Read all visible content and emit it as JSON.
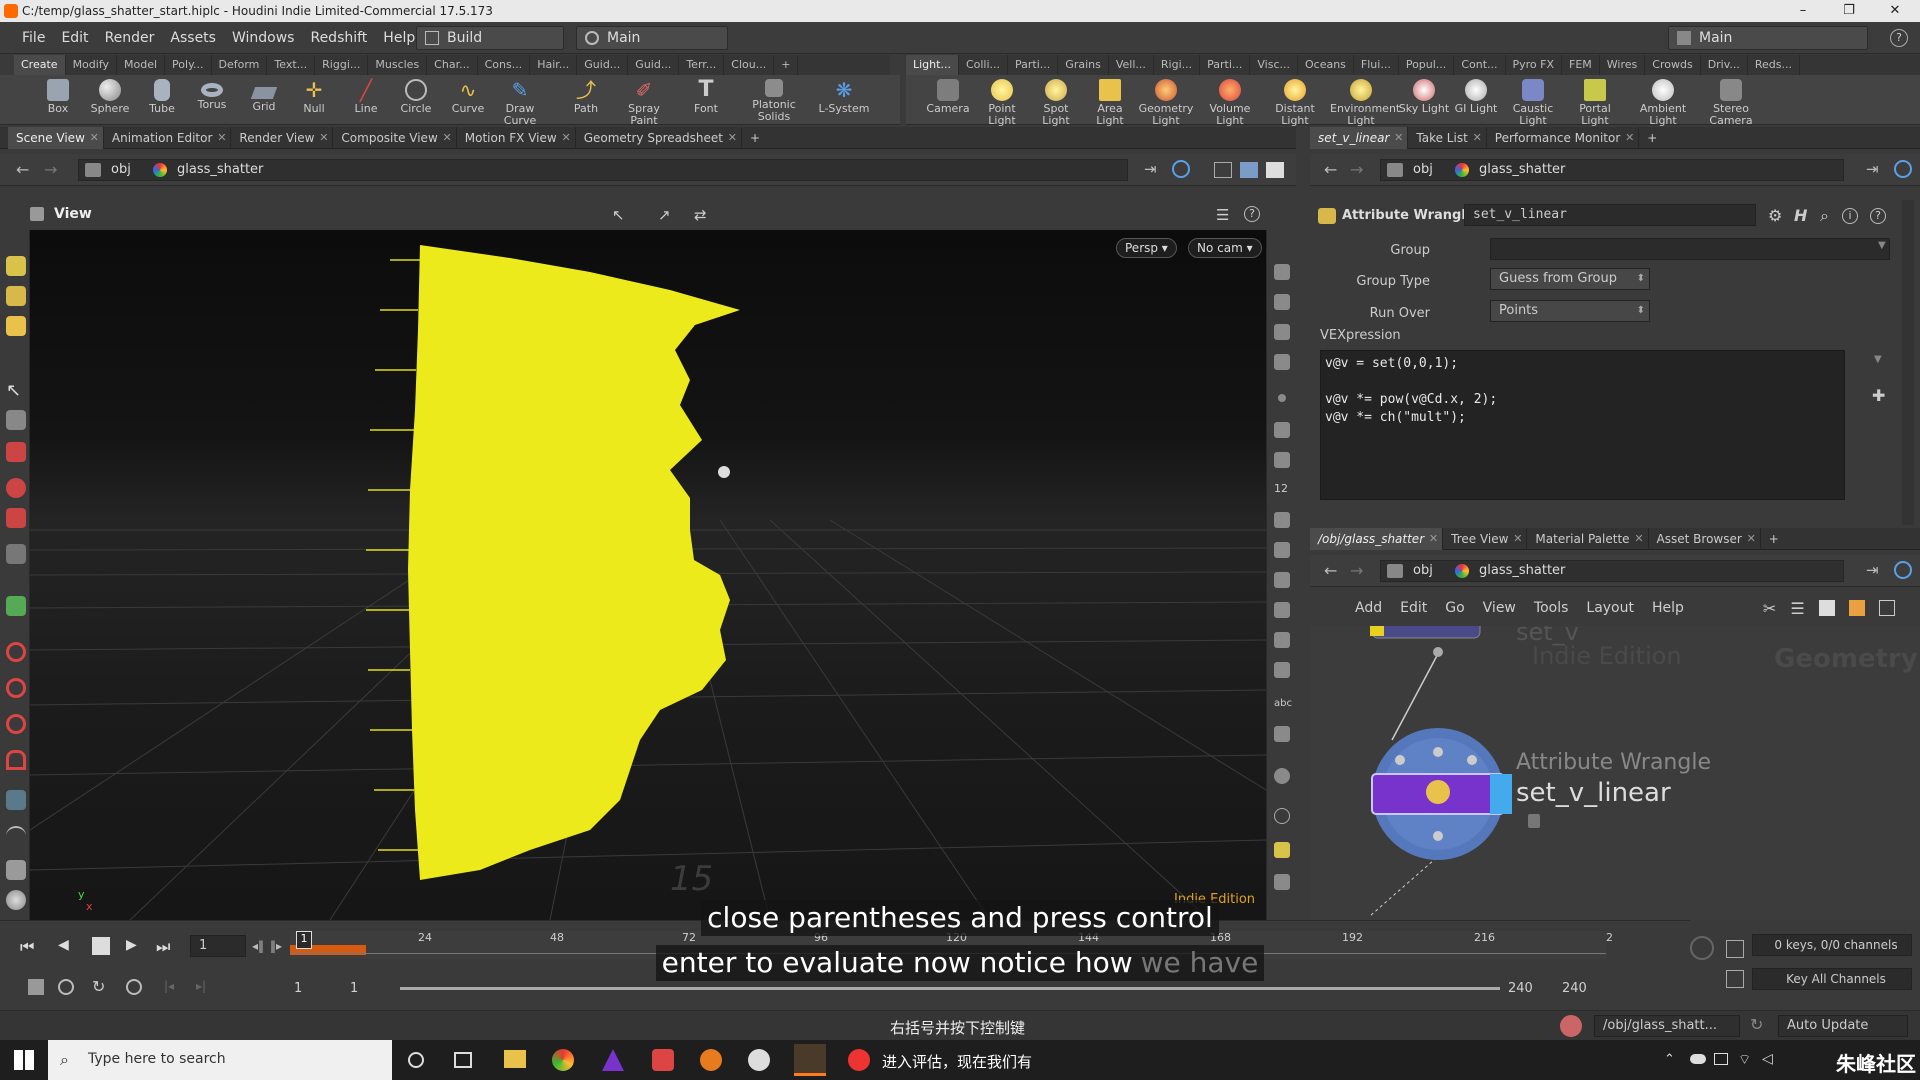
{
  "window": {
    "title": "C:/temp/glass_shatter_start.hiplc - Houdini Indie Limited-Commercial 17.5.173"
  },
  "menu": [
    "File",
    "Edit",
    "Render",
    "Assets",
    "Windows",
    "Redshift",
    "Help"
  ],
  "desktops": {
    "build": "Build",
    "main": "Main",
    "main_right": "Main"
  },
  "shelf_tabs_left": [
    "Create",
    "Modify",
    "Model",
    "Poly...",
    "Deform",
    "Text...",
    "Riggi...",
    "Muscles",
    "Char...",
    "Cons...",
    "Hair...",
    "Guid...",
    "Guid...",
    "Terr...",
    "Clou..."
  ],
  "shelf_tabs_right": [
    "Light...",
    "Colli...",
    "Parti...",
    "Grains",
    "Vell...",
    "Rigi...",
    "Parti...",
    "Visc...",
    "Oceans",
    "Flui...",
    "Popul...",
    "Cont...",
    "Pyro FX",
    "FEM",
    "Wires",
    "Crowds",
    "Driv...",
    "Reds..."
  ],
  "tools_left": [
    "Box",
    "Sphere",
    "Tube",
    "Torus",
    "Grid",
    "Null",
    "Line",
    "Circle",
    "Curve",
    "Draw Curve",
    "Path",
    "Spray Paint",
    "Font",
    "Platonic Solids",
    "L-System"
  ],
  "tools_right": [
    "Camera",
    "Point Light",
    "Spot Light",
    "Area Light",
    "Geometry Light",
    "Volume Light",
    "Distant Light",
    "Environment Light",
    "Sky Light",
    "GI Light",
    "Caustic Light",
    "Portal Light",
    "Ambient Light",
    "Stereo Camera"
  ],
  "pane_tabs_left": [
    "Scene View",
    "Animation Editor",
    "Render View",
    "Composite View",
    "Motion FX View",
    "Geometry Spreadsheet"
  ],
  "pane_tabs_params": [
    "set_v_linear",
    "Take List",
    "Performance Monitor"
  ],
  "pane_tabs_net": [
    "/obj/glass_shatter",
    "Tree View",
    "Material Palette",
    "Asset Browser"
  ],
  "path": {
    "obj": "obj",
    "node": "glass_shatter"
  },
  "viewport": {
    "title": "View",
    "persp": "Persp ▾",
    "cam": "No cam ▾",
    "watermark": "Indie Edition",
    "grid_number": "15"
  },
  "params": {
    "node_type": "Attribute Wrangle",
    "node_name": "set_v_linear",
    "group_label": "Group",
    "group_value": "",
    "group_type_label": "Group Type",
    "group_type_value": "Guess from Group",
    "run_over_label": "Run Over",
    "run_over_value": "Points",
    "vex_label": "VEXpression",
    "code_lines": [
      "v@v = set(0,0,1);",
      "",
      "v@v *= pow(v@Cd.x, 2);",
      "v@v *= ch(\"mult\");"
    ]
  },
  "network": {
    "menu": [
      "Add",
      "Edit",
      "Go",
      "View",
      "Tools",
      "Layout",
      "Help"
    ],
    "prev_node": "set_v",
    "watermark": "Indie Edition",
    "context_label": "Geometry",
    "node_type": "Attribute Wrangle",
    "node_name": "set_v_linear"
  },
  "timeline": {
    "current_frame": "1",
    "ticks": [
      "24",
      "48",
      "72",
      "96",
      "120",
      "144",
      "168",
      "192",
      "216",
      "2"
    ],
    "start": "1",
    "start2": "1",
    "end": "240",
    "end2": "240",
    "keys": "0 keys, 0/0 channels",
    "key_all": "Key All Channels"
  },
  "captions": {
    "line1": "close parentheses and press control",
    "line2a": "enter to evaluate now notice how",
    "line2b": "we have",
    "chinese1": "右括号并按下控制键",
    "chinese2": "进入评估，现在我们有"
  },
  "status": {
    "path": "/obj/glass_shatt...",
    "auto_update": "Auto Update"
  },
  "taskbar": {
    "search_placeholder": "Type here to search",
    "logo_text": "朱峰社区"
  }
}
